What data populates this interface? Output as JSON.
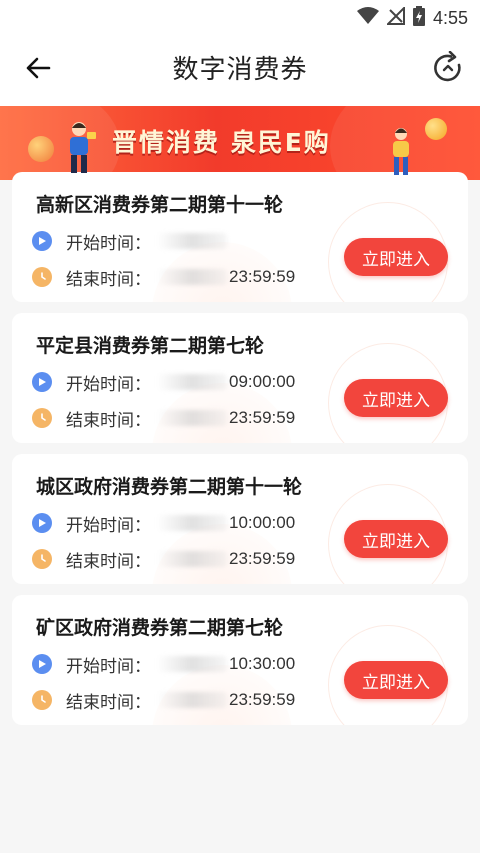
{
  "status_bar": {
    "time": "4:55",
    "icons": [
      "wifi-icon",
      "no-signal-icon",
      "battery-charging-icon"
    ]
  },
  "app_bar": {
    "title": "数字消费券",
    "back_icon": "arrow-left-icon",
    "refresh_icon": "refresh-icon"
  },
  "banner": {
    "slogan": "晋情消费 泉民E购"
  },
  "colors": {
    "accent": "#f2453d",
    "banner_red": "#f23b2b",
    "start_icon": "#5b8ef0",
    "end_icon": "#f5b565"
  },
  "vouchers": [
    {
      "title": "高新区消费券第二期第十一轮",
      "start_label": "开始时间：",
      "start_value": "",
      "end_label": "结束时间：",
      "end_value": "23:59:59",
      "button": "立即进入"
    },
    {
      "title": "平定县消费券第二期第七轮",
      "start_label": "开始时间：",
      "start_value": "09:00:00",
      "end_label": "结束时间：",
      "end_value": "23:59:59",
      "button": "立即进入"
    },
    {
      "title": "城区政府消费券第二期第十一轮",
      "start_label": "开始时间：",
      "start_value": "10:00:00",
      "end_label": "结束时间：",
      "end_value": "23:59:59",
      "button": "立即进入"
    },
    {
      "title": "矿区政府消费券第二期第七轮",
      "start_label": "开始时间：",
      "start_value": "10:30:00",
      "end_label": "结束时间：",
      "end_value": "23:59:59",
      "button": "立即进入"
    }
  ]
}
